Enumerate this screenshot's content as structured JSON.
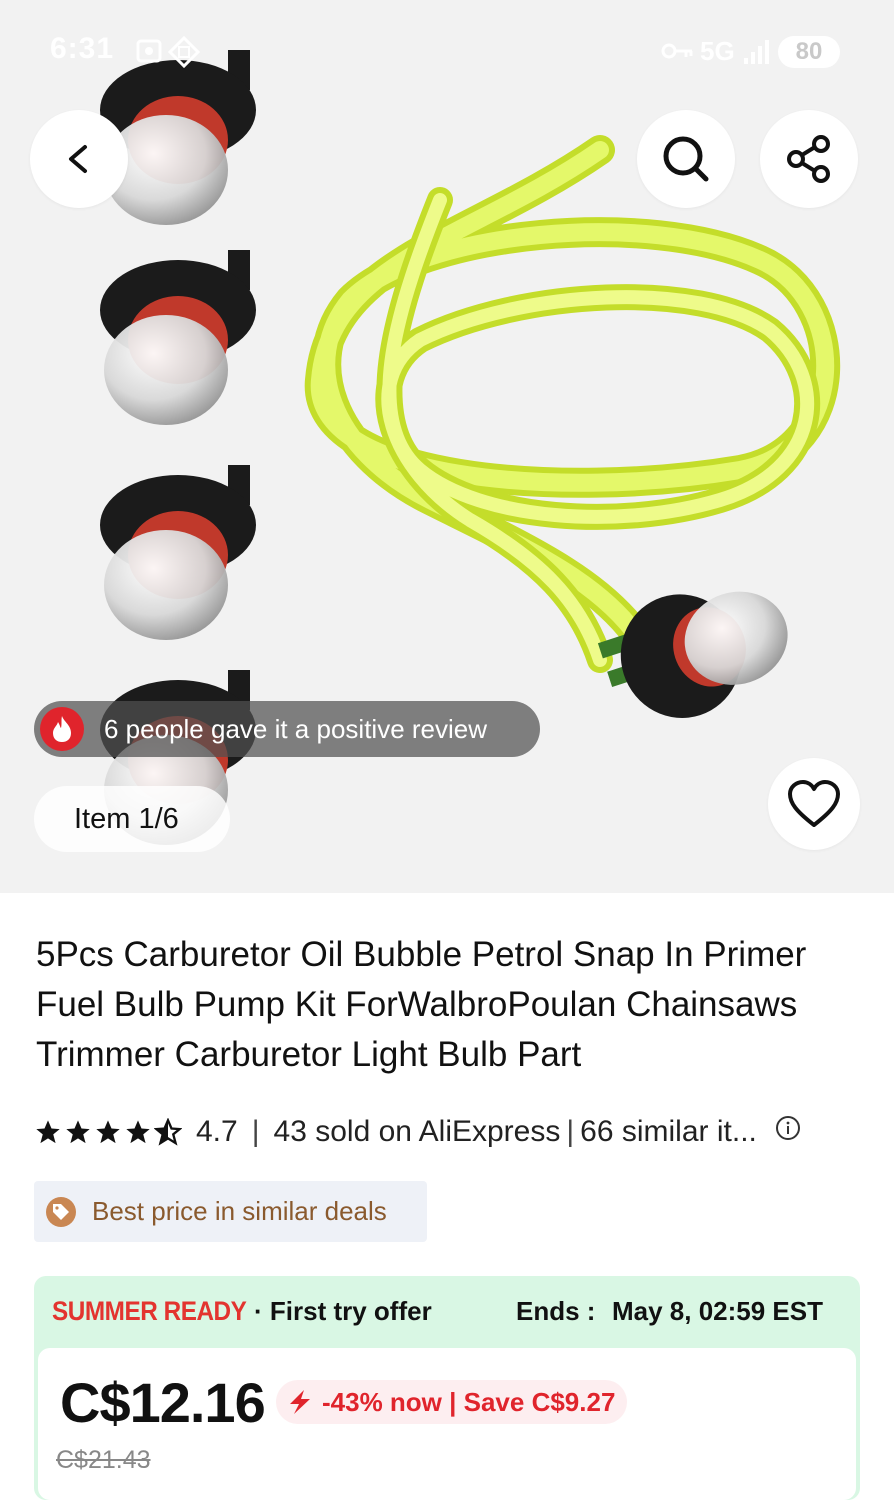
{
  "status_bar": {
    "time": "6:31",
    "network": "5G",
    "battery": "80"
  },
  "product_gallery": {
    "review_text": "6 people gave it a positive review",
    "item_counter": "Item 1/6"
  },
  "product": {
    "title": "5Pcs Carburetor Oil Bubble Petrol Snap In Primer Fuel Bulb Pump Kit ForWalbroPoulan Chainsaws Trimmer Carburetor Light Bulb Part",
    "rating": "4.7",
    "rating_stars": 4.7,
    "sold": "43 sold on AliExpress",
    "similar": "66 similar it...",
    "best_price_badge": "Best price in similar deals"
  },
  "deal": {
    "campaign": "SUMMER READY",
    "offer": "· First try offer",
    "ends_label": "Ends :",
    "ends_value": "May 8, 02:59 EST",
    "price": "C$12.16",
    "discount": "-43% now | Save C$9.27",
    "original_price": "C$21.43"
  },
  "colors": {
    "accent_red": "#e3342f",
    "deal_green": "#d9f7e4",
    "badge_brown": "#8a5a2e",
    "tube_yellow": "#d6f23a"
  },
  "icons": [
    "back-arrow-icon",
    "search-icon",
    "share-icon",
    "heart-icon",
    "fire-icon",
    "price-tag-icon",
    "info-icon",
    "lightning-icon"
  ]
}
